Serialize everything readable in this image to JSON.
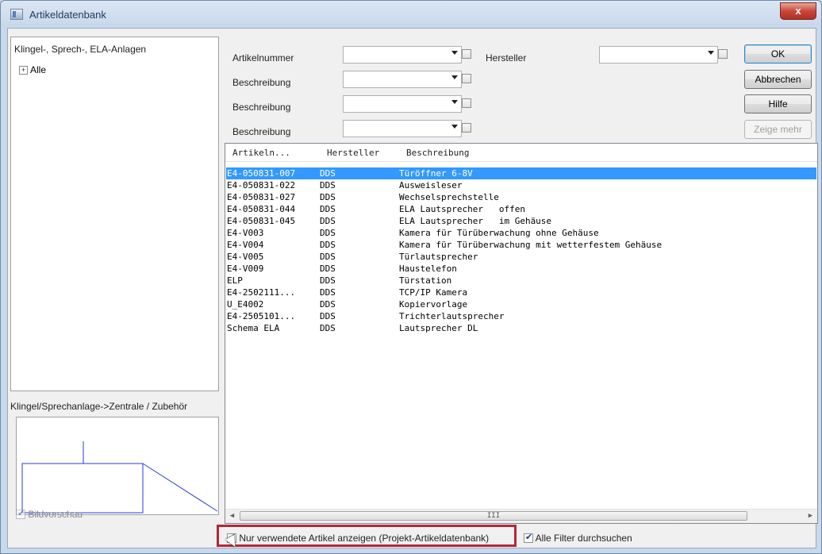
{
  "window": {
    "title": "Artikeldatenbank",
    "close_label": "x"
  },
  "left_panel": {
    "label": "Klingel-, Sprech-, ELA-Anlagen",
    "tree": [
      {
        "expander": "+",
        "label": "Alle"
      }
    ],
    "breadcrumb": "Klingel/Sprechanlage->Zentrale / Zubehör",
    "preview_checkbox_label": "Bildvorschau"
  },
  "filters": {
    "artikelnummer_label": "Artikelnummer",
    "beschreibung_label_1": "Beschreibung",
    "beschreibung_label_2": "Beschreibung",
    "beschreibung_label_3": "Beschreibung",
    "hersteller_label": "Hersteller",
    "artikelnummer_value": "",
    "hersteller_value": ""
  },
  "buttons": {
    "ok": "OK",
    "cancel": "Abbrechen",
    "help": "Hilfe",
    "show_more": "Zeige mehr"
  },
  "table": {
    "columns": [
      "Artikeln...",
      "Hersteller",
      "Beschreibung"
    ],
    "rows": [
      {
        "nr": "E4-050831-007",
        "hersteller": "DDS",
        "beschreibung": "Türöffner 6-8V",
        "selected": true
      },
      {
        "nr": "E4-050831-022",
        "hersteller": "DDS",
        "beschreibung": "Ausweisleser"
      },
      {
        "nr": "E4-050831-027",
        "hersteller": "DDS",
        "beschreibung": "Wechselsprechstelle"
      },
      {
        "nr": "E4-050831-044",
        "hersteller": "DDS",
        "beschreibung": "ELA Lautsprecher   offen"
      },
      {
        "nr": "E4-050831-045",
        "hersteller": "DDS",
        "beschreibung": "ELA Lautsprecher   im Gehäuse"
      },
      {
        "nr": "E4-V003",
        "hersteller": "DDS",
        "beschreibung": "Kamera für Türüberwachung ohne Gehäuse"
      },
      {
        "nr": "E4-V004",
        "hersteller": "DDS",
        "beschreibung": "Kamera für Türüberwachung mit wetterfestem Gehäuse"
      },
      {
        "nr": "E4-V005",
        "hersteller": "DDS",
        "beschreibung": "Türlautsprecher"
      },
      {
        "nr": "E4-V009",
        "hersteller": "DDS",
        "beschreibung": "Haustelefon"
      },
      {
        "nr": "ELP",
        "hersteller": "DDS",
        "beschreibung": "Türstation"
      },
      {
        "nr": "E4-2502111...",
        "hersteller": "DDS",
        "beschreibung": "TCP/IP Kamera"
      },
      {
        "nr": "U_E4002",
        "hersteller": "DDS",
        "beschreibung": "Kopiervorlage"
      },
      {
        "nr": "E4-2505101...",
        "hersteller": "DDS",
        "beschreibung": "Trichterlautsprecher"
      },
      {
        "nr": "Schema ELA",
        "hersteller": "DDS",
        "beschreibung": "Lautsprecher DL"
      }
    ],
    "scroll_thumb_glyph": "III"
  },
  "options": {
    "only_used_label": "Nur verwendete Artikel anzeigen (Projekt-Artikeldatenbank)",
    "only_used_checked": true,
    "all_filters_label": "Alle Filter durchsuchen",
    "all_filters_checked": true
  },
  "colors": {
    "selection": "#3399ff",
    "highlight_frame": "#b3283b",
    "preview_lines": "#2b3bd6"
  }
}
